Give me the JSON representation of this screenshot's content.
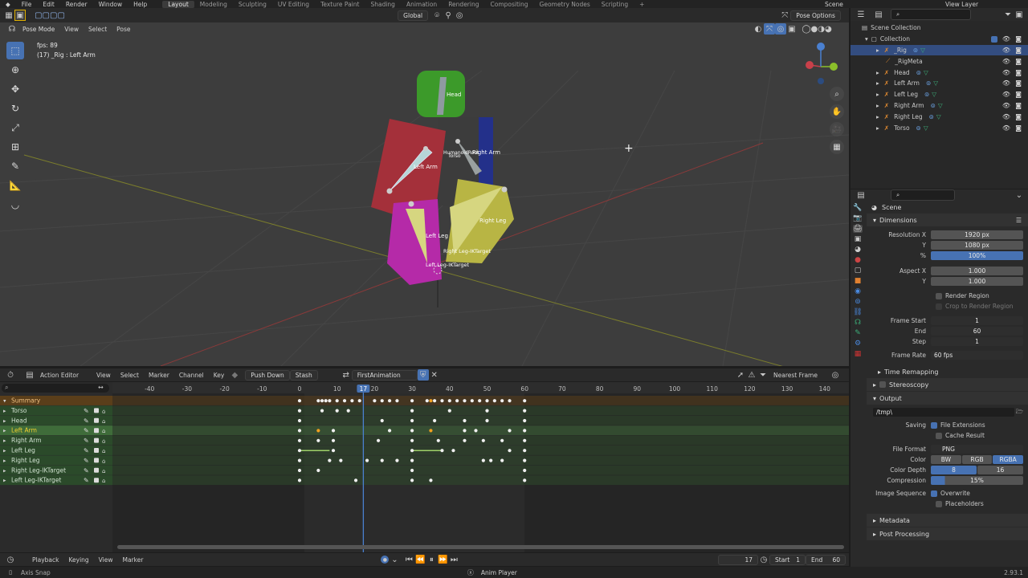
{
  "top_menu": [
    "File",
    "Edit",
    "Render",
    "Window",
    "Help"
  ],
  "workspaces": [
    "Layout",
    "Modeling",
    "Sculpting",
    "UV Editing",
    "Texture Paint",
    "Shading",
    "Animation",
    "Rendering",
    "Compositing",
    "Geometry Nodes",
    "Scripting"
  ],
  "active_workspace": "Layout",
  "scene_name": "Scene",
  "view_layer": "View Layer",
  "viewport": {
    "mode": "Pose Mode",
    "menus": [
      "View",
      "Select",
      "Pose"
    ],
    "transform_orientation": "Global",
    "pose_options": "Pose Options",
    "overlay_fps": "fps: 89",
    "overlay_object": "(17) _Rig : Left Arm",
    "bone_labels": [
      "Head",
      "Left Arm",
      "Right Arm",
      "Torso",
      "HumanoidRoot",
      "Left Leg",
      "Right Leg",
      "Right Leg-IKTarget",
      "Left Leg-IKTarget"
    ]
  },
  "action_editor": {
    "editor": "Action Editor",
    "menus": [
      "View",
      "Select",
      "Marker",
      "Channel",
      "Key"
    ],
    "push_down": "Push Down",
    "stash": "Stash",
    "action_name": "FirstAnimation",
    "snap": "Nearest Frame",
    "ruler": [
      "-40",
      "-30",
      "-20",
      "-10",
      "0",
      "10",
      "20",
      "30",
      "40",
      "50",
      "60",
      "70",
      "80",
      "90",
      "100",
      "110",
      "120",
      "130",
      "140"
    ],
    "current_frame": "17",
    "channels": [
      "Summary",
      "Torso",
      "Head",
      "Left Arm",
      "Right Arm",
      "Left Leg",
      "Right Leg",
      "Right Leg-IKTarget",
      "Left Leg-IKTarget"
    ]
  },
  "playback_bar": {
    "playback": "Playback",
    "keying": "Keying",
    "view": "View",
    "marker": "Marker",
    "frame": "17",
    "start_label": "Start",
    "start": "1",
    "end_label": "End",
    "end": "60"
  },
  "status_bar": {
    "left": "Axis Snap",
    "center": "Anim Player",
    "version": "2.93.1"
  },
  "outliner": {
    "scene_collection": "Scene Collection",
    "collection": "Collection",
    "items": [
      "_Rig",
      "_RigMeta",
      "Head",
      "Left Arm",
      "Left Leg",
      "Right Arm",
      "Right Leg",
      "Torso"
    ]
  },
  "properties": {
    "context": "Scene",
    "dimensions": "Dimensions",
    "res_x_label": "Resolution X",
    "res_x": "1920 px",
    "res_y_label": "Y",
    "res_y": "1080 px",
    "pct_label": "%",
    "pct": "100%",
    "aspect_x_label": "Aspect X",
    "aspect_x": "1.000",
    "aspect_y_label": "Y",
    "aspect_y": "1.000",
    "render_region": "Render Region",
    "crop": "Crop to Render Region",
    "frame_start_label": "Frame Start",
    "frame_start": "1",
    "end_label": "End",
    "end": "60",
    "step_label": "Step",
    "step": "1",
    "frame_rate_label": "Frame Rate",
    "frame_rate": "60 fps",
    "time_remapping": "Time Remapping",
    "stereoscopy": "Stereoscopy",
    "output": "Output",
    "output_path": "/tmp\\",
    "saving_label": "Saving",
    "file_ext": "File Extensions",
    "cache_result": "Cache Result",
    "file_format_label": "File Format",
    "file_format": "PNG",
    "color_label": "Color",
    "color_opts": [
      "BW",
      "RGB",
      "RGBA"
    ],
    "depth_label": "Color Depth",
    "depth_opts": [
      "8",
      "16"
    ],
    "compression_label": "Compression",
    "compression": "15%",
    "image_seq_label": "Image Sequence",
    "overwrite": "Overwrite",
    "placeholders": "Placeholders",
    "metadata": "Metadata",
    "post_processing": "Post Processing"
  },
  "colors": {
    "accent": "#4772b3",
    "active_row": "#3f6c3a",
    "summary_row": "#6b4a1e"
  }
}
